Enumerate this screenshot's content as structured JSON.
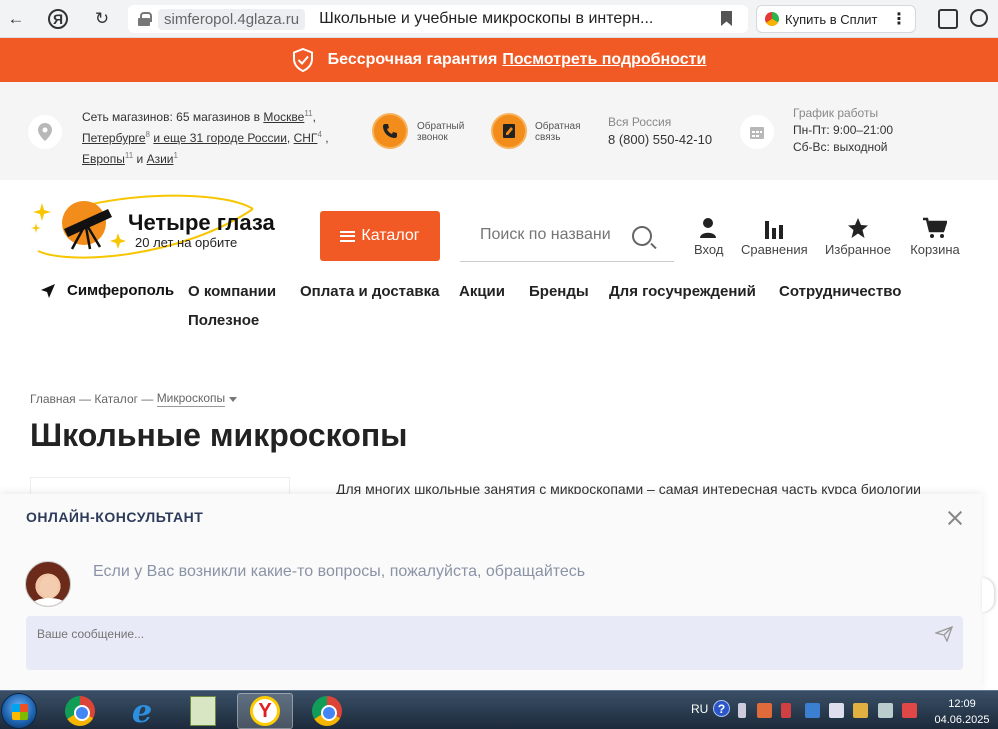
{
  "browser": {
    "domain": "simferopol.4glaza.ru",
    "page_title": "Школьные и учебные микроскопы в интерн...",
    "split_button": "Купить в Сплит"
  },
  "promo": {
    "text": "Бессрочная гарантия",
    "link": "Посмотреть подробности"
  },
  "info": {
    "stores": {
      "prefix": "Сеть магазинов: 65 магазинов в ",
      "moscow": "Москве",
      "moscow_count": "11",
      "spb": "Петербурге",
      "spb_count": "8",
      "more": "и еще 31 городе России",
      "cis": "СНГ",
      "cis_count": "4",
      "europe": "Европы",
      "europe_count": "11",
      "and": "и",
      "asia": "Азии",
      "asia_count": "1"
    },
    "callback": [
      "Обратный",
      "звонок"
    ],
    "feedback": [
      "Обратная",
      "связь"
    ],
    "russia_label": "Вся Россия",
    "phone": "8 (800) 550-42-10",
    "hours_label": "График работы",
    "hours_weekdays": "Пн-Пт: 9:00–21:00",
    "hours_weekend": "Сб-Вс: выходной"
  },
  "header": {
    "logo_name": "Четыре глаза",
    "logo_sub": "20 лет на орбите",
    "catalog": "Каталог",
    "search_placeholder": "Поиск по названи",
    "actions": [
      {
        "label": "Вход",
        "icon": "user-icon"
      },
      {
        "label": "Сравнения",
        "icon": "bar-chart-icon"
      },
      {
        "label": "Избранное",
        "icon": "star-icon"
      },
      {
        "label": "Корзина",
        "icon": "cart-icon"
      }
    ]
  },
  "nav": {
    "city": "Симферополь",
    "items": [
      "О компании",
      "Оплата и доставка",
      "Акции",
      "Бренды",
      "Для госучреждений",
      "Сотрудничество",
      "Полезное"
    ]
  },
  "breadcrumbs": [
    "Главная",
    "—",
    "Каталог",
    "—",
    "Микроскопы"
  ],
  "page": {
    "title": "Школьные микроскопы",
    "description": "Для многих школьные занятия с микроскопами – самая интересная часть курса биологии"
  },
  "chat": {
    "title": "ОНЛАЙН-КОНСУЛЬТАНТ",
    "greeting": "Если у Вас возникли какие-то вопросы, пожалуйста, обращайтесь",
    "placeholder": "Ваше сообщение..."
  },
  "taskbar": {
    "lang": "RU",
    "time": "12:09",
    "date": "04.06.2025"
  },
  "colors": {
    "accent": "#f15a24",
    "chat_title": "#2d3b5a",
    "msg_box": "#e8ebf7"
  }
}
